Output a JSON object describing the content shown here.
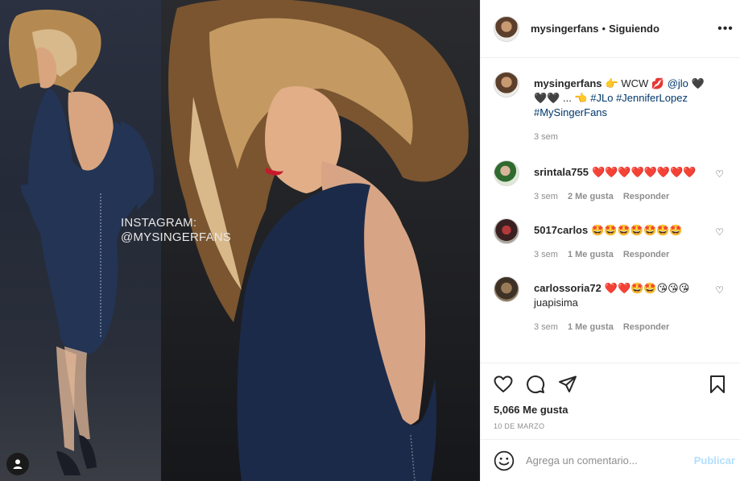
{
  "post": {
    "image": {
      "watermark_line1": "INSTAGRAM:",
      "watermark_line2": "@MYSINGERFANS"
    },
    "header": {
      "username": "mysingerfans",
      "separator": "•",
      "follow_status": "Siguiendo",
      "more_label": "•••"
    },
    "caption": {
      "username": "mysingerfans",
      "text_1": "👉 WCW 💋 ",
      "mention": "@jlo",
      "text_2": " 🖤🖤🖤 ... 👈 ",
      "hashtag_1": "#JLo",
      "hashtag_2": "#JenniferLopez",
      "hashtag_3": "#MySingerFans",
      "time": "3 sem"
    },
    "comments": [
      {
        "username": "srintala755",
        "text": "❤️❤️❤️❤️❤️❤️❤️❤️",
        "time": "3 sem",
        "likes": "2 Me gusta",
        "reply": "Responder"
      },
      {
        "username": "5017carlos",
        "text": "🤩🤩🤩🤩🤩🤩🤩",
        "time": "3 sem",
        "likes": "1 Me gusta",
        "reply": "Responder"
      },
      {
        "username": "carlossoria72",
        "text": "❤️❤️🤩🤩😘😘😘 juapisima",
        "time": "3 sem",
        "likes": "1 Me gusta",
        "reply": "Responder"
      }
    ],
    "likes_count": "5,066 Me gusta",
    "date": "10 DE MARZO",
    "add_comment": {
      "placeholder": "Agrega un comentario...",
      "publish_label": "Publicar"
    },
    "icons": {
      "like": "heart-outline-icon",
      "comment": "speech-bubble-icon",
      "share": "paper-plane-icon",
      "save": "bookmark-icon",
      "emoji": "smiley-icon",
      "user_tag": "person-icon"
    },
    "colors": {
      "link": "#00376b",
      "muted": "#8e8e8e",
      "publish_disabled": "#b2dffc",
      "border": "#efefef"
    }
  }
}
